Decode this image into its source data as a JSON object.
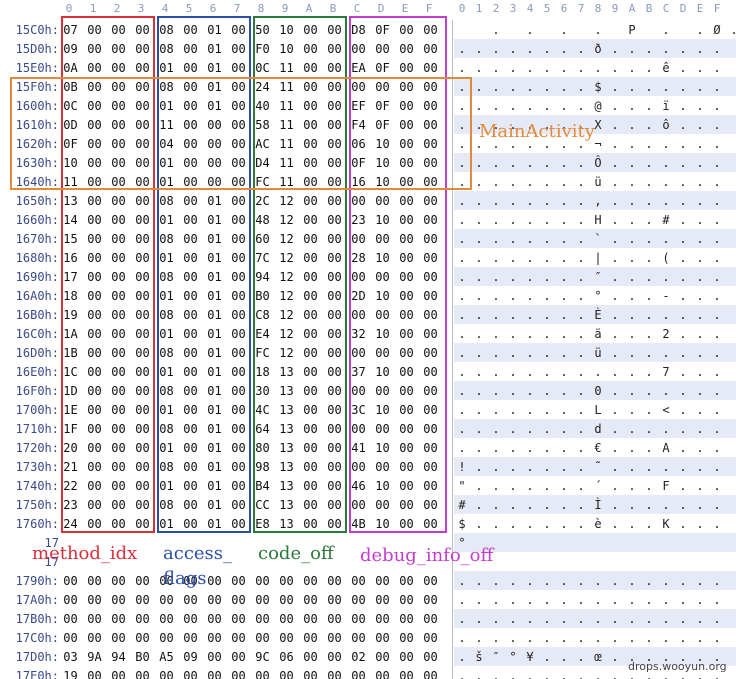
{
  "header": {
    "hex_columns": [
      "0",
      "1",
      "2",
      "3",
      "4",
      "5",
      "6",
      "7",
      "8",
      "9",
      "A",
      "B",
      "C",
      "D",
      "E",
      "F"
    ],
    "ascii_columns": [
      "0",
      "1",
      "2",
      "3",
      "4",
      "5",
      "6",
      "7",
      "8",
      "9",
      "A",
      "B",
      "C",
      "D",
      "E",
      "F"
    ]
  },
  "rows": [
    {
      "offset": "15C0h:",
      "bytes": [
        "07",
        "00",
        "00",
        "00",
        "08",
        "00",
        "01",
        "00",
        "50",
        "10",
        "00",
        "00",
        "D8",
        "0F",
        "00",
        "00"
      ],
      "ascii": [
        "",
        "",
        ".",
        "",
        ".",
        "",
        ".",
        "",
        ".",
        "",
        "P",
        "",
        ".",
        "",
        ".",
        "Ø",
        "."
      ]
    },
    {
      "offset": "15D0h:",
      "bytes": [
        "09",
        "00",
        "00",
        "00",
        "08",
        "00",
        "01",
        "00",
        "F0",
        "10",
        "00",
        "00",
        "00",
        "00",
        "00",
        "00"
      ],
      "ascii": [
        ".",
        ".",
        ".",
        ".",
        ".",
        ".",
        ".",
        ".",
        "ð",
        ".",
        ".",
        ".",
        ".",
        ".",
        ".",
        "."
      ]
    },
    {
      "offset": "15E0h:",
      "bytes": [
        "0A",
        "00",
        "00",
        "00",
        "01",
        "00",
        "01",
        "00",
        "0C",
        "11",
        "00",
        "00",
        "EA",
        "0F",
        "00",
        "00"
      ],
      "ascii": [
        ".",
        ".",
        ".",
        ".",
        ".",
        ".",
        ".",
        ".",
        ".",
        ".",
        ".",
        ".",
        "ê",
        ".",
        ".",
        "."
      ]
    },
    {
      "offset": "15F0h:",
      "bytes": [
        "0B",
        "00",
        "00",
        "00",
        "08",
        "00",
        "01",
        "00",
        "24",
        "11",
        "00",
        "00",
        "00",
        "00",
        "00",
        "00"
      ],
      "ascii": [
        ".",
        ".",
        ".",
        ".",
        ".",
        ".",
        ".",
        ".",
        "$",
        ".",
        ".",
        ".",
        ".",
        ".",
        ".",
        "."
      ]
    },
    {
      "offset": "1600h:",
      "bytes": [
        "0C",
        "00",
        "00",
        "00",
        "01",
        "00",
        "01",
        "00",
        "40",
        "11",
        "00",
        "00",
        "EF",
        "0F",
        "00",
        "00"
      ],
      "ascii": [
        ".",
        ".",
        ".",
        ".",
        ".",
        ".",
        ".",
        ".",
        "@",
        ".",
        ".",
        ".",
        "ï",
        ".",
        ".",
        "."
      ]
    },
    {
      "offset": "1610h:",
      "bytes": [
        "0D",
        "00",
        "00",
        "00",
        "11",
        "00",
        "00",
        "00",
        "58",
        "11",
        "00",
        "00",
        "F4",
        "0F",
        "00",
        "00"
      ],
      "ascii": [
        ".",
        ".",
        ".",
        ".",
        ".",
        ".",
        ".",
        ".",
        "X",
        ".",
        ".",
        ".",
        "ô",
        ".",
        ".",
        "."
      ]
    },
    {
      "offset": "1620h:",
      "bytes": [
        "0F",
        "00",
        "00",
        "00",
        "04",
        "00",
        "00",
        "00",
        "AC",
        "11",
        "00",
        "00",
        "06",
        "10",
        "00",
        "00"
      ],
      "ascii": [
        ".",
        ".",
        ".",
        ".",
        ".",
        ".",
        ".",
        ".",
        "¬",
        ".",
        ".",
        ".",
        ".",
        ".",
        ".",
        "."
      ]
    },
    {
      "offset": "1630h:",
      "bytes": [
        "10",
        "00",
        "00",
        "00",
        "01",
        "00",
        "00",
        "00",
        "D4",
        "11",
        "00",
        "00",
        "0F",
        "10",
        "00",
        "00"
      ],
      "ascii": [
        ".",
        ".",
        ".",
        ".",
        ".",
        ".",
        ".",
        ".",
        "Ô",
        ".",
        ".",
        ".",
        ".",
        ".",
        ".",
        "."
      ]
    },
    {
      "offset": "1640h:",
      "bytes": [
        "11",
        "00",
        "00",
        "00",
        "01",
        "00",
        "00",
        "00",
        "FC",
        "11",
        "00",
        "00",
        "16",
        "10",
        "00",
        "00"
      ],
      "ascii": [
        ".",
        ".",
        ".",
        ".",
        ".",
        ".",
        ".",
        ".",
        "ü",
        ".",
        ".",
        ".",
        ".",
        ".",
        ".",
        "."
      ]
    },
    {
      "offset": "1650h:",
      "bytes": [
        "13",
        "00",
        "00",
        "00",
        "08",
        "00",
        "01",
        "00",
        "2C",
        "12",
        "00",
        "00",
        "00",
        "00",
        "00",
        "00"
      ],
      "ascii": [
        ".",
        ".",
        ".",
        ".",
        ".",
        ".",
        ".",
        ".",
        ",",
        ".",
        ".",
        ".",
        ".",
        ".",
        ".",
        "."
      ]
    },
    {
      "offset": "1660h:",
      "bytes": [
        "14",
        "00",
        "00",
        "00",
        "01",
        "00",
        "01",
        "00",
        "48",
        "12",
        "00",
        "00",
        "23",
        "10",
        "00",
        "00"
      ],
      "ascii": [
        ".",
        ".",
        ".",
        ".",
        ".",
        ".",
        ".",
        ".",
        "H",
        ".",
        ".",
        ".",
        "#",
        ".",
        ".",
        "."
      ]
    },
    {
      "offset": "1670h:",
      "bytes": [
        "15",
        "00",
        "00",
        "00",
        "08",
        "00",
        "01",
        "00",
        "60",
        "12",
        "00",
        "00",
        "00",
        "00",
        "00",
        "00"
      ],
      "ascii": [
        ".",
        ".",
        ".",
        ".",
        ".",
        ".",
        ".",
        ".",
        "`",
        ".",
        ".",
        ".",
        ".",
        ".",
        ".",
        "."
      ]
    },
    {
      "offset": "1680h:",
      "bytes": [
        "16",
        "00",
        "00",
        "00",
        "01",
        "00",
        "01",
        "00",
        "7C",
        "12",
        "00",
        "00",
        "28",
        "10",
        "00",
        "00"
      ],
      "ascii": [
        ".",
        ".",
        ".",
        ".",
        ".",
        ".",
        ".",
        ".",
        "|",
        ".",
        ".",
        ".",
        "(",
        ".",
        ".",
        "."
      ]
    },
    {
      "offset": "1690h:",
      "bytes": [
        "17",
        "00",
        "00",
        "00",
        "08",
        "00",
        "01",
        "00",
        "94",
        "12",
        "00",
        "00",
        "00",
        "00",
        "00",
        "00"
      ],
      "ascii": [
        ".",
        ".",
        ".",
        ".",
        ".",
        ".",
        ".",
        ".",
        "″",
        ".",
        ".",
        ".",
        ".",
        ".",
        ".",
        "."
      ]
    },
    {
      "offset": "16A0h:",
      "bytes": [
        "18",
        "00",
        "00",
        "00",
        "01",
        "00",
        "01",
        "00",
        "B0",
        "12",
        "00",
        "00",
        "2D",
        "10",
        "00",
        "00"
      ],
      "ascii": [
        ".",
        ".",
        ".",
        ".",
        ".",
        ".",
        ".",
        ".",
        "°",
        ".",
        ".",
        ".",
        "-",
        ".",
        ".",
        "."
      ]
    },
    {
      "offset": "16B0h:",
      "bytes": [
        "19",
        "00",
        "00",
        "00",
        "08",
        "00",
        "01",
        "00",
        "C8",
        "12",
        "00",
        "00",
        "00",
        "00",
        "00",
        "00"
      ],
      "ascii": [
        ".",
        ".",
        ".",
        ".",
        ".",
        ".",
        ".",
        ".",
        "È",
        ".",
        ".",
        ".",
        ".",
        ".",
        ".",
        "."
      ]
    },
    {
      "offset": "16C0h:",
      "bytes": [
        "1A",
        "00",
        "00",
        "00",
        "01",
        "00",
        "01",
        "00",
        "E4",
        "12",
        "00",
        "00",
        "32",
        "10",
        "00",
        "00"
      ],
      "ascii": [
        ".",
        ".",
        ".",
        ".",
        ".",
        ".",
        ".",
        ".",
        "ä",
        ".",
        ".",
        ".",
        "2",
        ".",
        ".",
        "."
      ]
    },
    {
      "offset": "16D0h:",
      "bytes": [
        "1B",
        "00",
        "00",
        "00",
        "08",
        "00",
        "01",
        "00",
        "FC",
        "12",
        "00",
        "00",
        "00",
        "00",
        "00",
        "00"
      ],
      "ascii": [
        ".",
        ".",
        ".",
        ".",
        ".",
        ".",
        ".",
        ".",
        "ü",
        ".",
        ".",
        ".",
        ".",
        ".",
        ".",
        "."
      ]
    },
    {
      "offset": "16E0h:",
      "bytes": [
        "1C",
        "00",
        "00",
        "00",
        "01",
        "00",
        "01",
        "00",
        "18",
        "13",
        "00",
        "00",
        "37",
        "10",
        "00",
        "00"
      ],
      "ascii": [
        ".",
        ".",
        ".",
        ".",
        ".",
        ".",
        ".",
        ".",
        ".",
        ".",
        ".",
        ".",
        "7",
        ".",
        ".",
        "."
      ]
    },
    {
      "offset": "16F0h:",
      "bytes": [
        "1D",
        "00",
        "00",
        "00",
        "08",
        "00",
        "01",
        "00",
        "30",
        "13",
        "00",
        "00",
        "00",
        "00",
        "00",
        "00"
      ],
      "ascii": [
        ".",
        ".",
        ".",
        ".",
        ".",
        ".",
        ".",
        ".",
        "0",
        ".",
        ".",
        ".",
        ".",
        ".",
        ".",
        "."
      ]
    },
    {
      "offset": "1700h:",
      "bytes": [
        "1E",
        "00",
        "00",
        "00",
        "01",
        "00",
        "01",
        "00",
        "4C",
        "13",
        "00",
        "00",
        "3C",
        "10",
        "00",
        "00"
      ],
      "ascii": [
        ".",
        ".",
        ".",
        ".",
        ".",
        ".",
        ".",
        ".",
        "L",
        ".",
        ".",
        ".",
        "<",
        ".",
        ".",
        "."
      ]
    },
    {
      "offset": "1710h:",
      "bytes": [
        "1F",
        "00",
        "00",
        "00",
        "08",
        "00",
        "01",
        "00",
        "64",
        "13",
        "00",
        "00",
        "00",
        "00",
        "00",
        "00"
      ],
      "ascii": [
        ".",
        ".",
        ".",
        ".",
        ".",
        ".",
        ".",
        ".",
        "d",
        ".",
        ".",
        ".",
        ".",
        ".",
        ".",
        "."
      ]
    },
    {
      "offset": "1720h:",
      "bytes": [
        "20",
        "00",
        "00",
        "00",
        "01",
        "00",
        "01",
        "00",
        "80",
        "13",
        "00",
        "00",
        "41",
        "10",
        "00",
        "00"
      ],
      "ascii": [
        ".",
        ".",
        ".",
        ".",
        ".",
        ".",
        ".",
        ".",
        "€",
        ".",
        ".",
        ".",
        "A",
        ".",
        ".",
        "."
      ]
    },
    {
      "offset": "1730h:",
      "bytes": [
        "21",
        "00",
        "00",
        "00",
        "08",
        "00",
        "01",
        "00",
        "98",
        "13",
        "00",
        "00",
        "00",
        "00",
        "00",
        "00"
      ],
      "ascii": [
        "!",
        ".",
        ".",
        ".",
        ".",
        ".",
        ".",
        ".",
        "˜",
        ".",
        ".",
        ".",
        ".",
        ".",
        ".",
        "."
      ]
    },
    {
      "offset": "1740h:",
      "bytes": [
        "22",
        "00",
        "00",
        "00",
        "01",
        "00",
        "01",
        "00",
        "B4",
        "13",
        "00",
        "00",
        "46",
        "10",
        "00",
        "00"
      ],
      "ascii": [
        "\"",
        ".",
        ".",
        ".",
        ".",
        ".",
        ".",
        ".",
        "´",
        ".",
        ".",
        ".",
        "F",
        ".",
        ".",
        "."
      ]
    },
    {
      "offset": "1750h:",
      "bytes": [
        "23",
        "00",
        "00",
        "00",
        "08",
        "00",
        "01",
        "00",
        "CC",
        "13",
        "00",
        "00",
        "00",
        "00",
        "00",
        "00"
      ],
      "ascii": [
        "#",
        ".",
        ".",
        ".",
        ".",
        ".",
        ".",
        ".",
        "Ì",
        ".",
        ".",
        ".",
        ".",
        ".",
        ".",
        "."
      ]
    },
    {
      "offset": "1760h:",
      "bytes": [
        "24",
        "00",
        "00",
        "00",
        "01",
        "00",
        "01",
        "00",
        "E8",
        "13",
        "00",
        "00",
        "4B",
        "10",
        "00",
        "00"
      ],
      "ascii": [
        "$",
        ".",
        ".",
        ".",
        ".",
        ".",
        ".",
        ".",
        "è",
        ".",
        ".",
        ".",
        "K",
        ".",
        ".",
        "."
      ]
    },
    {
      "offset": "17",
      "bytes": [
        "",
        "",
        "",
        "",
        "",
        "",
        "",
        "",
        "",
        "",
        "",
        "",
        "",
        "",
        "",
        ""
      ],
      "ascii": [
        "°",
        "",
        "",
        "",
        "",
        "",
        "",
        "",
        "",
        "",
        "",
        "",
        "",
        "",
        "",
        ""
      ]
    },
    {
      "offset": "17",
      "bytes": [
        "",
        "",
        "",
        "",
        "",
        "",
        "",
        "",
        "",
        "",
        "",
        "",
        "",
        "",
        "",
        ""
      ],
      "ascii": [
        "",
        "",
        "",
        "",
        "",
        "",
        "",
        "",
        "",
        "",
        "",
        "",
        "",
        "",
        "",
        ""
      ]
    },
    {
      "offset": "1790h:",
      "bytes": [
        "00",
        "00",
        "00",
        "00",
        "00",
        "00",
        "00",
        "00",
        "00",
        "00",
        "00",
        "00",
        "00",
        "00",
        "00",
        "00"
      ],
      "ascii": [
        ".",
        ".",
        ".",
        ".",
        ".",
        ".",
        ".",
        ".",
        ".",
        ".",
        ".",
        ".",
        ".",
        ".",
        ".",
        "."
      ]
    },
    {
      "offset": "17A0h:",
      "bytes": [
        "00",
        "00",
        "00",
        "00",
        "00",
        "00",
        "00",
        "00",
        "00",
        "00",
        "00",
        "00",
        "00",
        "00",
        "00",
        "00"
      ],
      "ascii": [
        ".",
        ".",
        ".",
        ".",
        ".",
        ".",
        ".",
        ".",
        ".",
        ".",
        ".",
        ".",
        ".",
        ".",
        ".",
        "."
      ]
    },
    {
      "offset": "17B0h:",
      "bytes": [
        "00",
        "00",
        "00",
        "00",
        "00",
        "00",
        "00",
        "00",
        "00",
        "00",
        "00",
        "00",
        "00",
        "00",
        "00",
        "00"
      ],
      "ascii": [
        ".",
        ".",
        ".",
        ".",
        ".",
        ".",
        ".",
        ".",
        ".",
        ".",
        ".",
        ".",
        ".",
        ".",
        ".",
        "."
      ]
    },
    {
      "offset": "17C0h:",
      "bytes": [
        "00",
        "00",
        "00",
        "00",
        "00",
        "00",
        "00",
        "00",
        "00",
        "00",
        "00",
        "00",
        "00",
        "00",
        "00",
        "00"
      ],
      "ascii": [
        ".",
        ".",
        ".",
        ".",
        ".",
        ".",
        ".",
        ".",
        ".",
        ".",
        ".",
        ".",
        ".",
        ".",
        ".",
        "."
      ]
    },
    {
      "offset": "17D0h:",
      "bytes": [
        "03",
        "9A",
        "94",
        "B0",
        "A5",
        "09",
        "00",
        "00",
        "9C",
        "06",
        "00",
        "00",
        "02",
        "00",
        "00",
        "00"
      ],
      "ascii": [
        ".",
        "š",
        "″",
        "°",
        "¥",
        ".",
        ".",
        ".",
        "œ",
        ".",
        ".",
        ".",
        ".",
        ".",
        ".",
        "."
      ]
    },
    {
      "offset": "17E0h:",
      "bytes": [
        "19",
        "00",
        "00",
        "00",
        "00",
        "00",
        "00",
        "00",
        "00",
        "00",
        "00",
        "00",
        "00",
        "00",
        "00",
        "00"
      ],
      "ascii": [
        ".",
        ".",
        ".",
        ".",
        ".",
        ".",
        ".",
        ".",
        ".",
        ".",
        ".",
        ".",
        ".",
        ".",
        ".",
        "."
      ]
    }
  ],
  "annotations": {
    "main_activity": "MainActivity",
    "method_idx": "method_idx",
    "access_flags_1": "access_",
    "access_flags_2": "flags",
    "code_off": "code_off",
    "debug_info_off": "debug_info_off"
  },
  "colors": {
    "method_idx": "#d9303a",
    "access_flags": "#2a4fa8",
    "code_off": "#2a7a3a",
    "debug_info_off": "#c43ccf",
    "main_activity": "#e08a3a"
  },
  "watermark": "drops.wooyun.org"
}
